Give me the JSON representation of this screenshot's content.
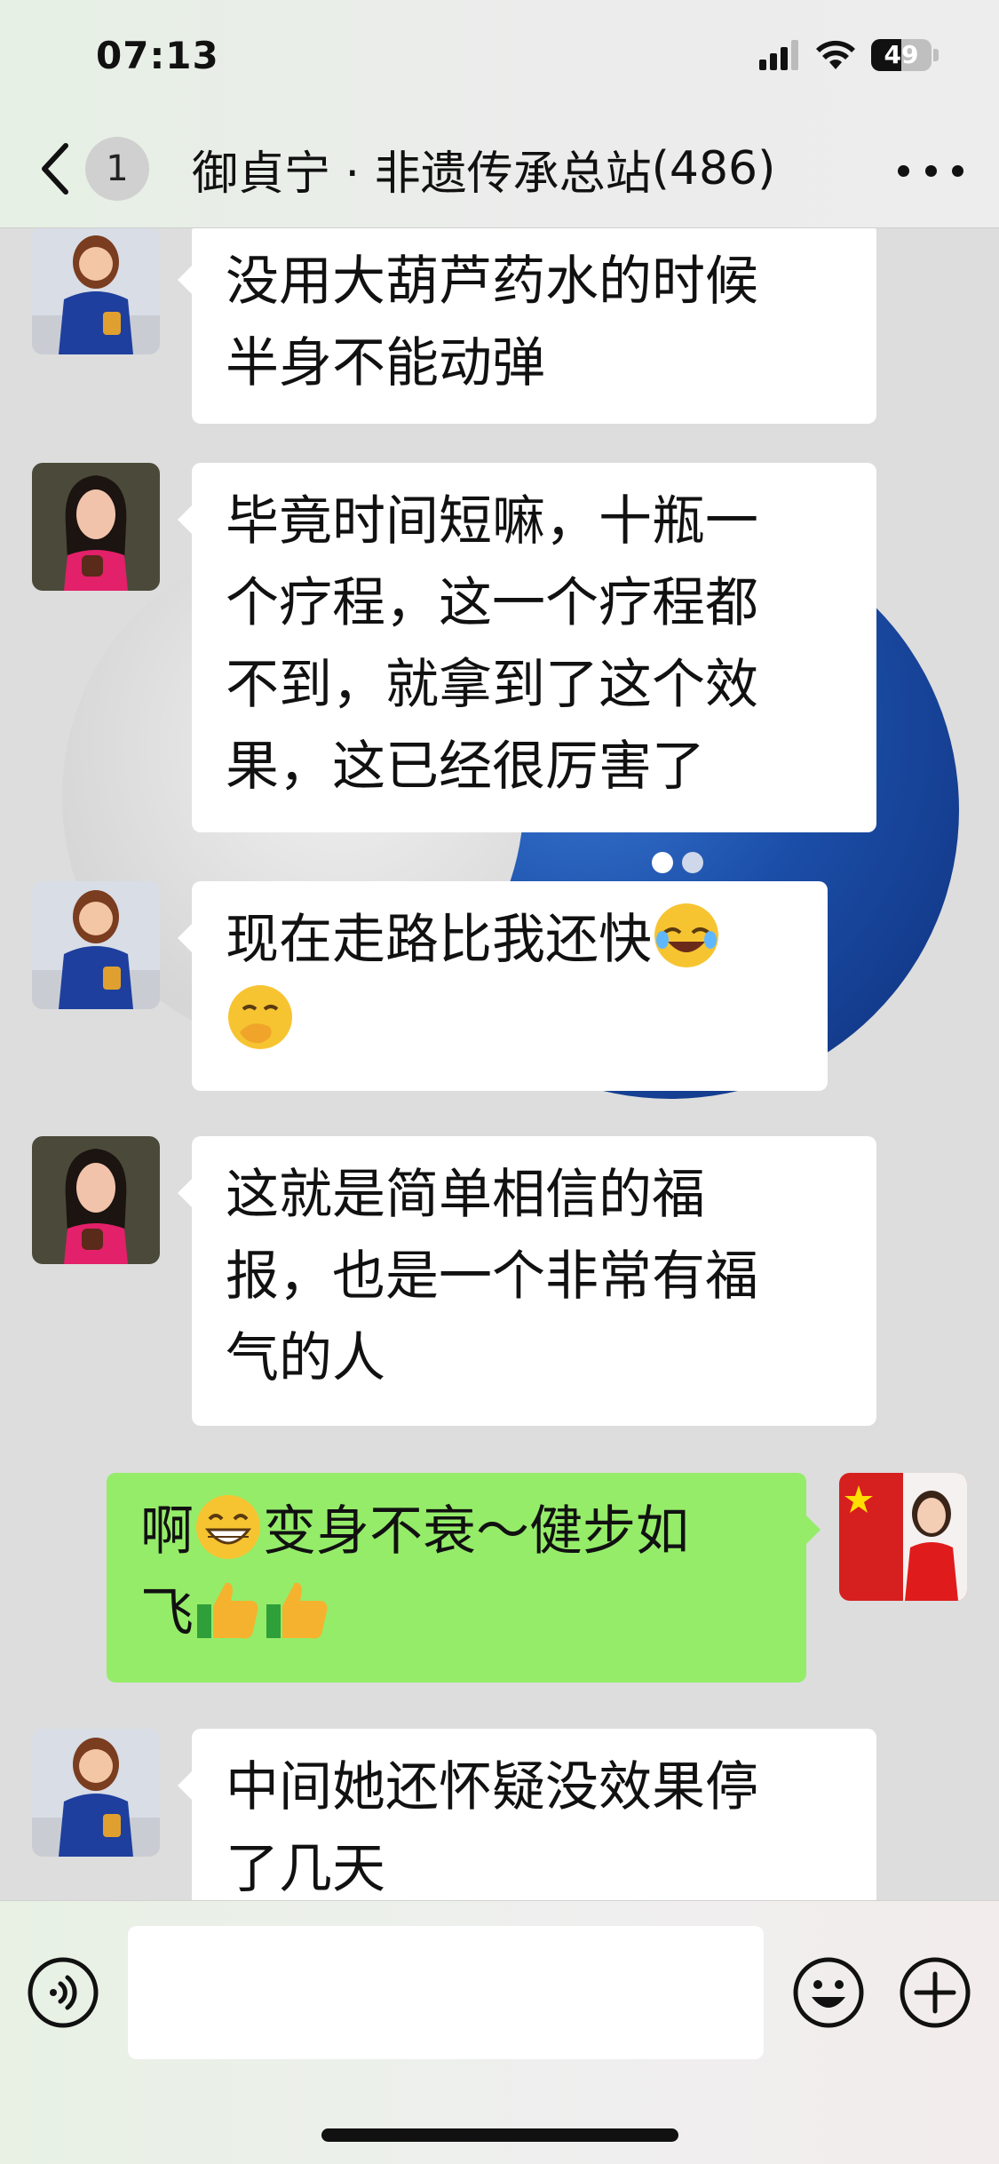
{
  "status_bar": {
    "time": "07:13",
    "battery": "49"
  },
  "nav": {
    "unread_count": "1",
    "title": "御貞宁 · 非遗传承总站",
    "member_count": "(486)"
  },
  "messages": [
    {
      "sender": "other",
      "avatar": "blue-blazer-woman",
      "lines": [
        "没用大葫芦药水的时候",
        "半身不能动弹"
      ]
    },
    {
      "sender": "other",
      "avatar": "red-scarf-woman",
      "lines": [
        "毕竟时间短嘛，十瓶一",
        "个疗程，这一个疗程都",
        "不到，就拿到了这个效",
        "果，这已经很厉害了"
      ]
    },
    {
      "sender": "other",
      "avatar": "blue-blazer-woman",
      "line1": "现在走路比我还快",
      "emoji1": "rolling-on-floor-laughing",
      "emoji2": "hand-over-mouth-face"
    },
    {
      "sender": "other",
      "avatar": "red-scarf-woman",
      "lines": [
        "这就是简单相信的福",
        "报，也是一个非常有福",
        "气的人"
      ]
    },
    {
      "sender": "self",
      "avatar": "flag-red-dress-woman",
      "line1_a": "啊",
      "emoji_grin": "grinning-face",
      "line1_b": "变身不衰～健步如",
      "line2": "飞",
      "emoji_thumbs": "thumbs-up"
    },
    {
      "sender": "other",
      "avatar": "blue-blazer-woman",
      "lines": [
        "中间她还怀疑没效果停",
        "了几天"
      ]
    }
  ],
  "input": {
    "placeholder": "",
    "value": ""
  },
  "icons": {
    "back": "chevron-left-icon",
    "more": "more-dots-icon",
    "voice": "voice-icon",
    "emoji": "emoji-face-icon",
    "plus": "plus-icon"
  },
  "colors": {
    "self_bubble": "#95ec69",
    "other_bubble": "#ffffff",
    "chat_bg": "#dddddd",
    "carousel_dot_active": "#ffffff",
    "carousel_dot_inactive": "#cfd8ea"
  }
}
